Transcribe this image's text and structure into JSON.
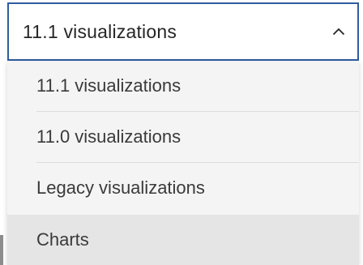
{
  "dropdown": {
    "selected_value": "11.1 visualizations",
    "expanded": true,
    "chevron_icon": "chevron-up-icon",
    "border_color": "#2e5c9e",
    "options": [
      {
        "label": "11.1 visualizations"
      },
      {
        "label": "11.0 visualizations"
      },
      {
        "label": "Legacy visualizations"
      },
      {
        "label": "Charts"
      }
    ],
    "hovered_option": "Charts"
  }
}
